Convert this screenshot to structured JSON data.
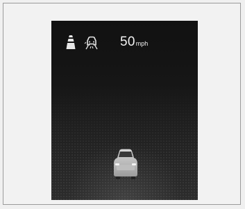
{
  "display": {
    "set_speed": "50",
    "speed_unit": "mph"
  },
  "icons": {
    "lane": "lane-keeping-icon",
    "car_sensor": "vehicle-detection-icon",
    "vehicle": "own-vehicle-icon"
  },
  "colors": {
    "screen_background": "#151515",
    "text": "#f2f2f2"
  }
}
